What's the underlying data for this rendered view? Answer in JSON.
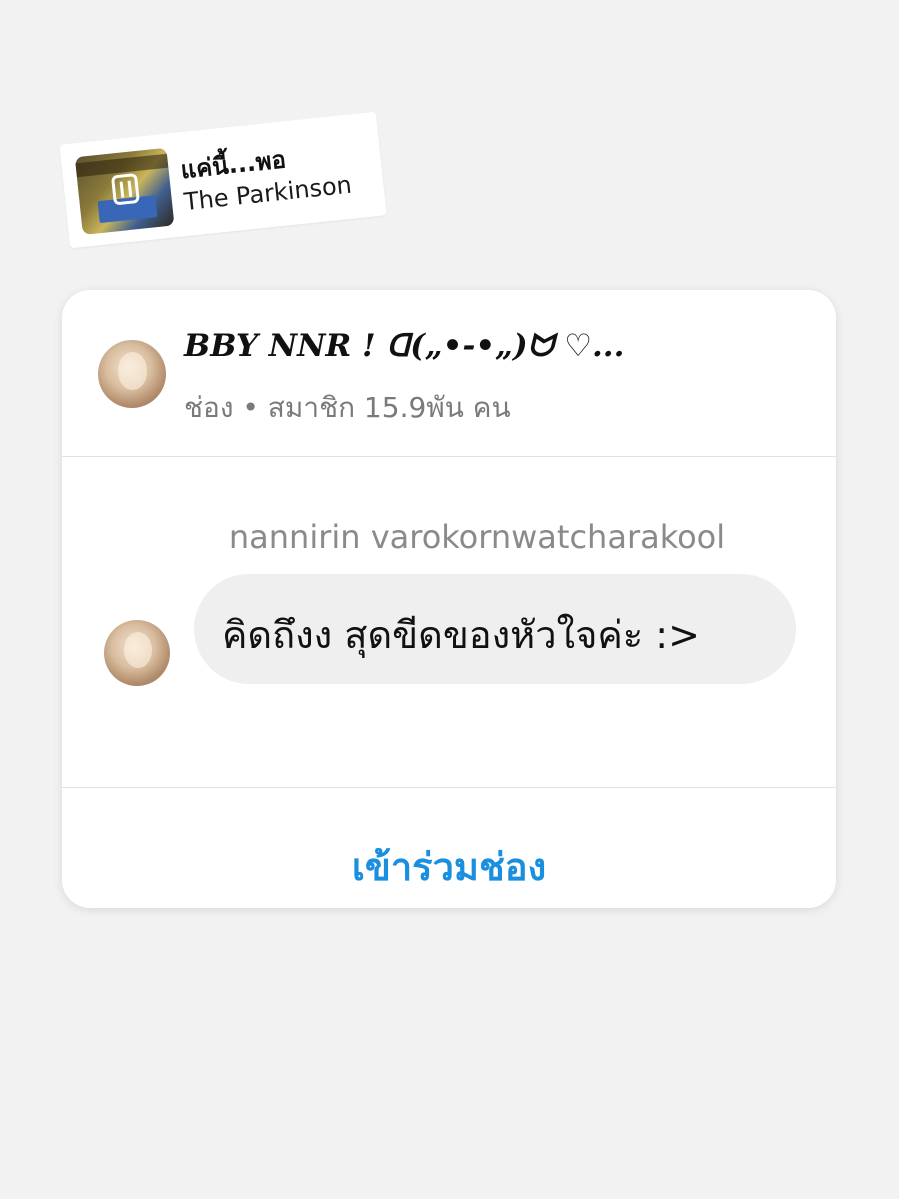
{
  "music_sticker": {
    "song_title": "แค่นี้...พอ",
    "artist": "The Parkinson",
    "icon": "music-bars-icon"
  },
  "channel": {
    "name": "BBY NNR ! ᗡ(„•-•„)ᗢ ♡...",
    "meta": "ช่อง • สมาชิก 15.9พัน คน"
  },
  "message": {
    "sender": "nannirin varokornwatcharakool",
    "text": "คิดถึงง สุดขีดของหัวใจค่ะ :>"
  },
  "actions": {
    "join_label": "เข้าร่วมช่อง"
  },
  "colors": {
    "accent": "#1a8fe0",
    "background": "#f2f2f2",
    "bubble": "#efefef",
    "meta_text": "#7a7a7a"
  }
}
